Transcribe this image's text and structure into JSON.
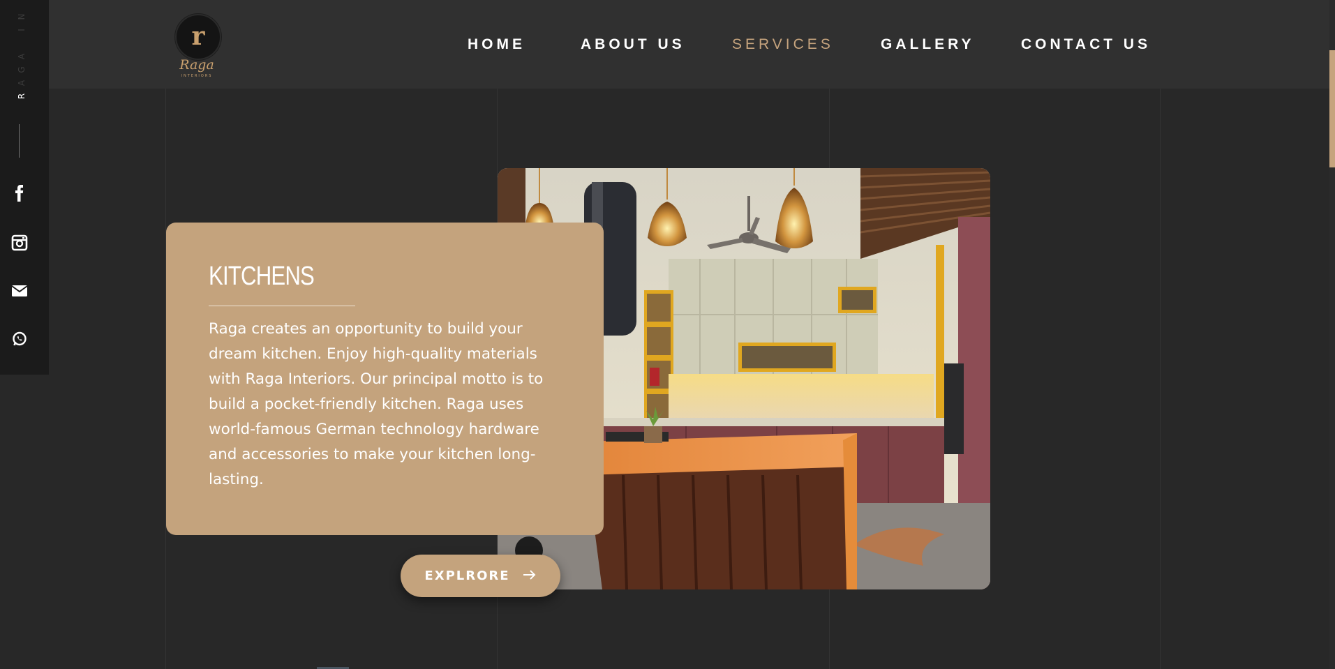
{
  "brand": {
    "logo_letter": "r",
    "logo_word": "Raga",
    "logo_sub": "INTERIORS",
    "accent_color": "#c6a47e",
    "side_text": "RAGA IN"
  },
  "nav": {
    "items": [
      {
        "label": "HOME",
        "active": false
      },
      {
        "label": "ABOUT US",
        "active": false
      },
      {
        "label": "SERVICES",
        "active": true
      },
      {
        "label": "GALLERY",
        "active": false
      },
      {
        "label": "CONTACT US",
        "active": false
      }
    ]
  },
  "social": {
    "icons": [
      "facebook-icon",
      "instagram-icon",
      "mail-icon",
      "whatsapp-icon"
    ]
  },
  "service": {
    "title": "KITCHENS",
    "description": "Raga creates an opportunity to build your dream kitchen. Enjoy high-quality materials with Raga Interiors. Our principal motto is to build a pocket-friendly kitchen. Raga uses world-famous German technology hardware and accessories to make your kitchen long-lasting.",
    "button_label": "EXPLRORE",
    "card_color": "#c4a37d"
  }
}
